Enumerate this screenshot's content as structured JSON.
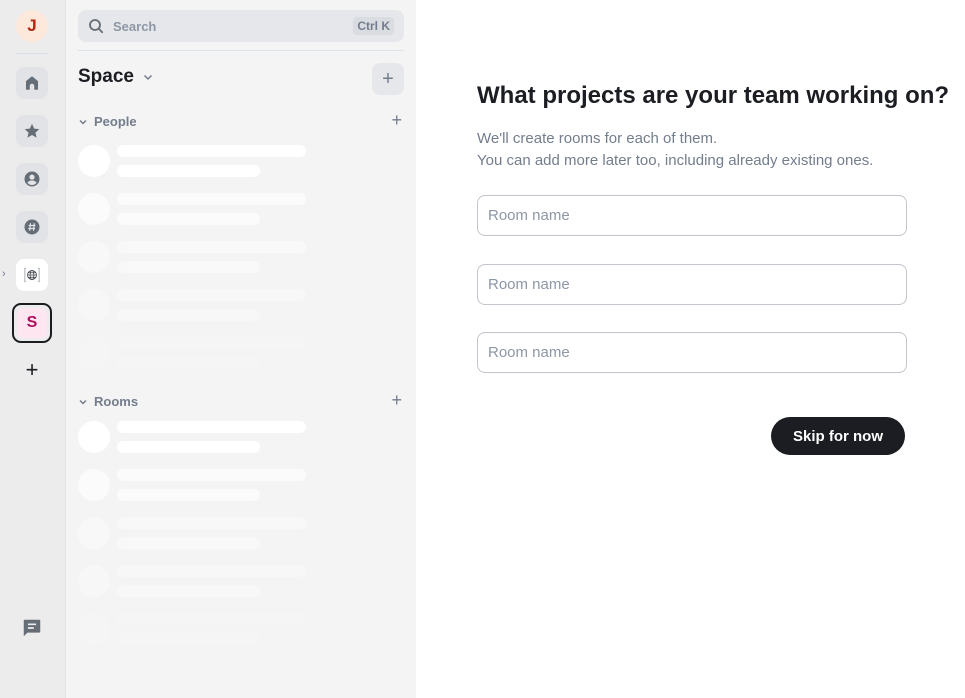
{
  "spacebar": {
    "user_avatar_initial": "J",
    "items": [
      {
        "name": "home",
        "icon": "home-icon"
      },
      {
        "name": "favourites",
        "icon": "star-icon"
      },
      {
        "name": "people",
        "icon": "person-icon"
      },
      {
        "name": "other-rooms",
        "icon": "hash-icon"
      },
      {
        "name": "public-space",
        "icon": "globe-icon"
      }
    ],
    "selected_space_initial": "S",
    "create_space_label": "+"
  },
  "roomlist": {
    "search_placeholder": "Search",
    "search_shortcut": "Ctrl K",
    "space_title": "Space",
    "add_label": "+",
    "sections": [
      {
        "label": "People",
        "add_label": "+",
        "skeleton_rows": 5
      },
      {
        "label": "Rooms",
        "add_label": "+",
        "skeleton_rows": 5
      }
    ]
  },
  "main": {
    "heading": "What projects are your team working on?",
    "description_line1": "We'll create rooms for each of them.",
    "description_line2": "You can add more later too, including already existing ones.",
    "room_inputs": [
      {
        "placeholder": "Room name",
        "value": ""
      },
      {
        "placeholder": "Room name",
        "value": ""
      },
      {
        "placeholder": "Room name",
        "value": ""
      }
    ],
    "skip_button": "Skip for now"
  },
  "colors": {
    "accent_dark": "#1b1d22",
    "secondary_text": "#737d8c",
    "avatar_bg": "#fde8dc",
    "avatar_text": "#b3260f",
    "space_s_bg": "#fde6ef",
    "space_s_text": "#ac0f5e"
  }
}
